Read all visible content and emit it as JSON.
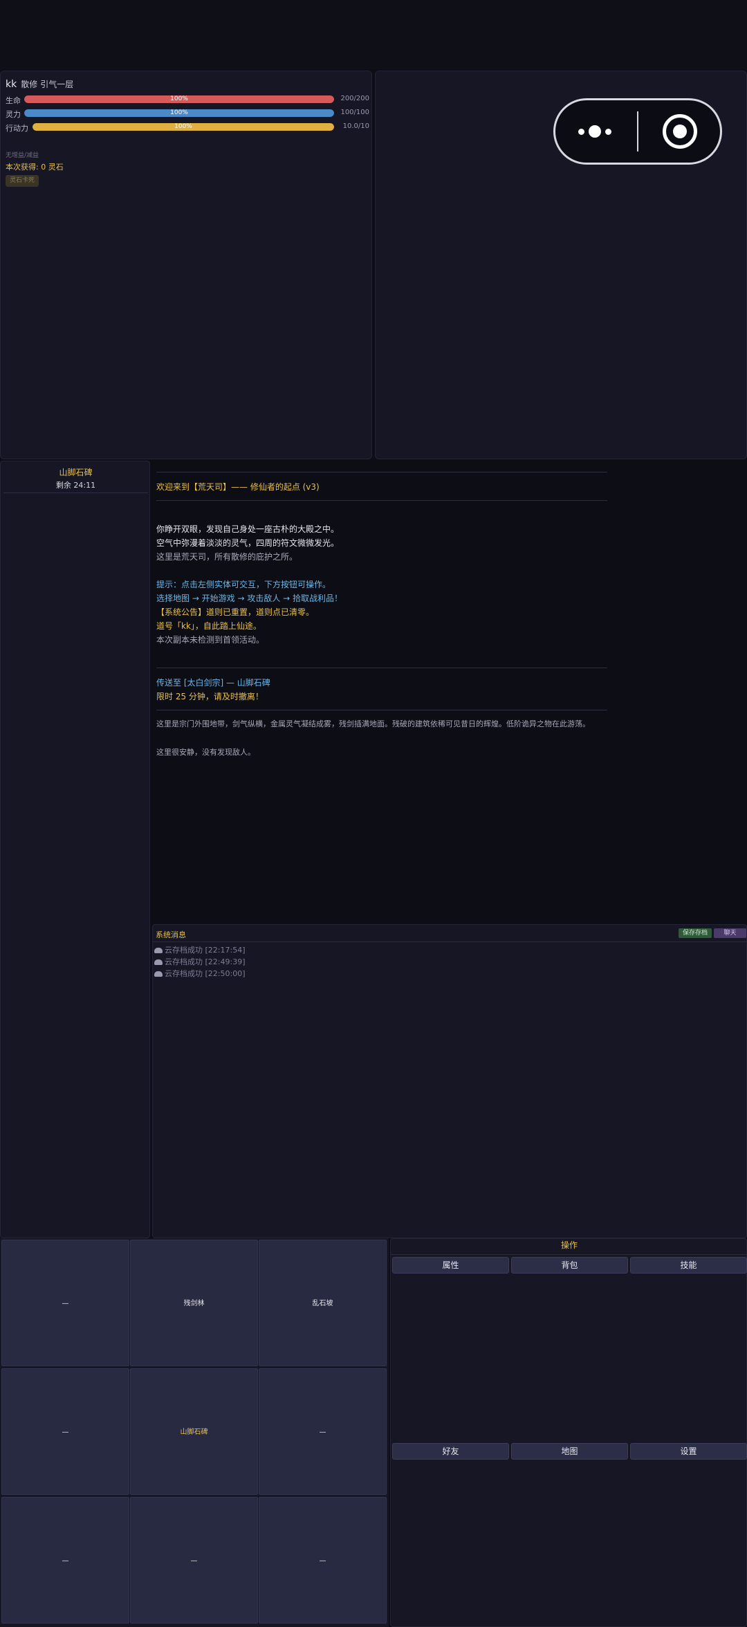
{
  "player": {
    "name": "kk",
    "sect": "散修",
    "realm": "引气一层"
  },
  "stats": [
    {
      "label": "生命",
      "pct_text": "100%",
      "value": "200/200",
      "fraction": 1.0,
      "color": "#d65a5a"
    },
    {
      "label": "灵力",
      "pct_text": "100%",
      "value": "100/100",
      "fraction": 1.0,
      "color": "#4a8ac8"
    },
    {
      "label": "行动力",
      "pct_text": "100%",
      "value": "10.0/10",
      "fraction": 1.0,
      "color": "#e0b040"
    }
  ],
  "status": {
    "effects": "无增益/减益",
    "gain": "本次获得: 0 灵石",
    "stone_button": "灵石卡死"
  },
  "location": {
    "name": "山脚石碑",
    "remaining": "剩余 24:11"
  },
  "story": {
    "welcome": "欢迎来到【荒天司】—— 修仙者的起点 (v3)",
    "lines": [
      "你睁开双眼，发现自己身处一座古朴的大殿之中。",
      "空气中弥漫着淡淡的灵气，四周的符文微微发光。",
      "这里是荒天司，所有散修的庇护之所。",
      "提示：点击左侧实体可交互，下方按钮可操作。",
      "选择地图 → 开始游戏 → 攻击敌人 → 拾取战利品！",
      "【系统公告】道则已重置，道则点已清零。",
      "道号「kk」，自此踏上仙途。",
      "本次副本未检测到首领活动。"
    ],
    "teleport": "传送至 [太白剑宗] — 山脚石碑",
    "time_limit": "限时 25 分钟，请及时撤离！",
    "area_desc": "这里是宗门外围地带，剑气纵横，金属灵气凝结成雾，残剑插满地面。残破的建筑依稀可见昔日的辉煌。低阶诡异之物在此游荡。",
    "enemy_status": "这里很安静，没有发现敌人。"
  },
  "messages": {
    "title": "系统消息",
    "save_button": "保存存档",
    "chat_button": "聊天",
    "logs": [
      "云存档成功 [22:17:54]",
      "云存档成功 [22:49:39]",
      "云存档成功 [22:50:00]"
    ]
  },
  "map_grid": [
    "—",
    "残剑林",
    "乱石坡",
    "—",
    "山脚石碑",
    "—",
    "—",
    "—",
    "—"
  ],
  "operations": {
    "title": "操作",
    "buttons": [
      "属性",
      "背包",
      "技能",
      "好友",
      "地图",
      "设置"
    ]
  }
}
